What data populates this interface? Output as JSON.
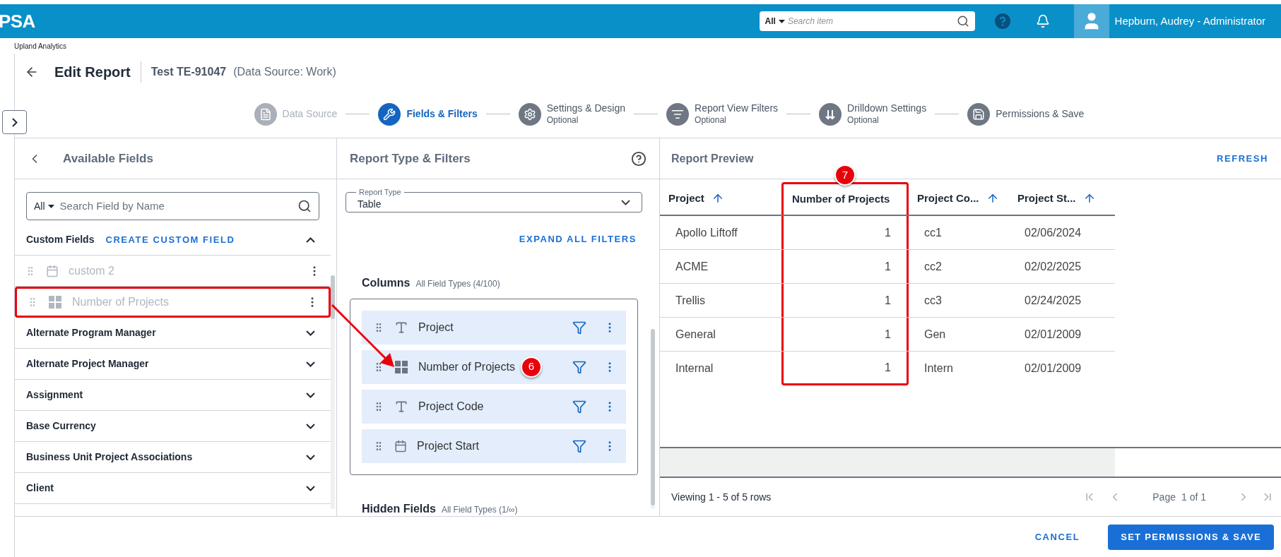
{
  "topbar": {
    "logo": "PSA",
    "search": {
      "scope": "All",
      "placeholder": "Search item"
    },
    "user": "Hepburn, Audrey - Administrator"
  },
  "app_name": "Upland Analytics",
  "header": {
    "title": "Edit Report",
    "report": "Test TE-91047",
    "source": "(Data Source: Work)"
  },
  "steps": [
    {
      "kind": "source",
      "label": "Data Source",
      "selected": false,
      "completed": true
    },
    {
      "kind": "fields",
      "label": "Fields & Filters",
      "selected": true,
      "completed": false
    },
    {
      "kind": "settings",
      "label": "Settings & Design",
      "subtitle": "Optional",
      "selected": false,
      "completed": false
    },
    {
      "kind": "filters",
      "label": "Report View Filters",
      "subtitle": "Optional",
      "selected": false,
      "completed": false
    },
    {
      "kind": "drilldown",
      "label": "Drilldown Settings",
      "subtitle": "Optional",
      "selected": false,
      "completed": false
    },
    {
      "kind": "save",
      "label": "Permissions & Save",
      "selected": false,
      "completed": false
    }
  ],
  "available": {
    "title": "Available Fields",
    "search": {
      "scope": "All",
      "placeholder": "Search Field by Name"
    },
    "custom": {
      "title": "Custom Fields",
      "action": "CREATE CUSTOM FIELD",
      "expanded": true,
      "fields": [
        {
          "kind": "date",
          "label": "custom 2",
          "disabled": true,
          "highlighted": false
        },
        {
          "kind": "number",
          "label": "Number of Projects",
          "disabled": true,
          "highlighted": true
        }
      ]
    },
    "groups": [
      {
        "label": "Alternate Program Manager",
        "expanded": false
      },
      {
        "label": "Alternate Project Manager",
        "expanded": false
      },
      {
        "label": "Assignment",
        "expanded": false
      },
      {
        "label": "Base Currency",
        "expanded": false
      },
      {
        "label": "Business Unit Project Associations",
        "expanded": false
      },
      {
        "label": "Client",
        "expanded": false
      }
    ]
  },
  "report_type": {
    "title": "Report Type & Filters",
    "select": {
      "label": "Report Type",
      "value": "Table"
    },
    "expand_action": "EXPAND ALL FILTERS",
    "columns": {
      "title": "Columns",
      "hint": "All Field Types (4/100)",
      "items": [
        {
          "kind": "text",
          "label": "Project"
        },
        {
          "kind": "number",
          "label": "Number of Projects",
          "callout": "6"
        },
        {
          "kind": "text",
          "label": "Project Code"
        },
        {
          "kind": "date",
          "label": "Project Start"
        }
      ]
    },
    "hidden": {
      "title": "Hidden Fields",
      "hint": "All Field Types (1/∞)"
    }
  },
  "preview": {
    "title": "Report Preview",
    "refresh": "REFRESH",
    "columns": [
      {
        "kind": "text",
        "label": "Project",
        "sorted": true,
        "highlighted": false
      },
      {
        "kind": "number",
        "label": "Number of Projects",
        "sorted": false,
        "highlighted": true,
        "callout": "7"
      },
      {
        "kind": "text",
        "label": "Project Co...",
        "sorted": true,
        "highlighted": false
      },
      {
        "kind": "text",
        "label": "Project St...",
        "sorted": true,
        "highlighted": false
      }
    ],
    "rows": [
      [
        "Apollo Liftoff",
        "1",
        "cc1",
        "02/06/2024"
      ],
      [
        "ACME",
        "1",
        "cc2",
        "02/02/2025"
      ],
      [
        "Trellis",
        "1",
        "cc3",
        "02/24/2025"
      ],
      [
        "General",
        "1",
        "Gen",
        "02/01/2009"
      ],
      [
        "Internal",
        "1",
        "Intern",
        "02/01/2009"
      ]
    ],
    "viewing": "Viewing 1 - 5 of 5 rows",
    "page_label": "Page",
    "page": "1 of 1"
  },
  "footer": {
    "cancel": "CANCEL",
    "save": "SET PERMISSIONS & SAVE"
  }
}
